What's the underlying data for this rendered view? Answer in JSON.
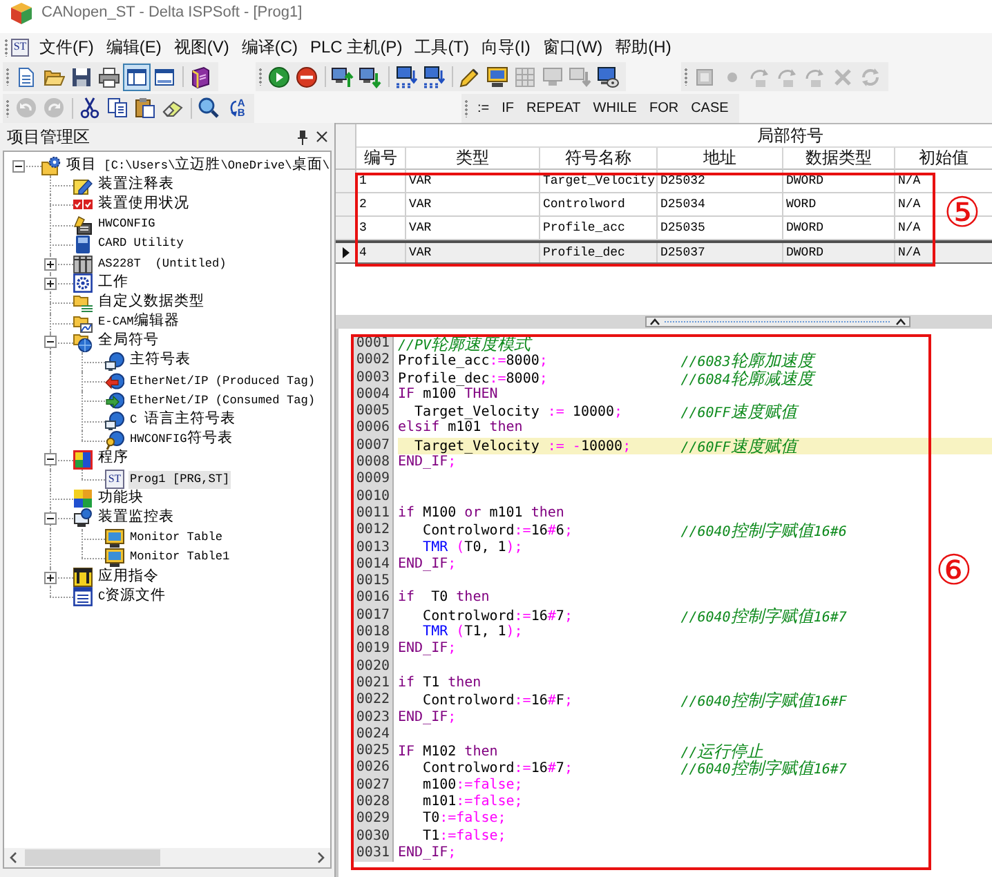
{
  "window": {
    "title": "CANopen_ST - Delta ISPSoft - [Prog1]"
  },
  "menu_bar": {
    "badge": "ST",
    "items": [
      "文件(F)",
      "编辑(E)",
      "视图(V)",
      "编译(C)",
      "PLC 主机(P)",
      "工具(T)",
      "向导(I)",
      "窗口(W)",
      "帮助(H)"
    ]
  },
  "toolbars": [
    {
      "groups": [
        {
          "sections": [
            {
              "buttons": [
                {
                  "kind": "new",
                  "disabled": false,
                  "pressed": false
                },
                {
                  "kind": "open",
                  "disabled": false,
                  "pressed": false
                },
                {
                  "kind": "save",
                  "disabled": false,
                  "pressed": false
                },
                {
                  "kind": "print",
                  "disabled": false,
                  "pressed": false
                },
                {
                  "kind": "layout",
                  "disabled": false,
                  "pressed": true
                },
                {
                  "kind": "window",
                  "disabled": false,
                  "pressed": false
                }
              ]
            },
            {
              "buttons": [
                {
                  "kind": "book",
                  "disabled": false,
                  "pressed": false
                }
              ]
            }
          ]
        },
        {
          "sections": [
            {
              "buttons": [
                {
                  "kind": "run",
                  "disabled": false
                },
                {
                  "kind": "stop",
                  "disabled": false
                }
              ]
            },
            {
              "buttons": [
                {
                  "kind": "upload",
                  "disabled": false
                },
                {
                  "kind": "download",
                  "disabled": false
                }
              ]
            },
            {
              "buttons": [
                {
                  "kind": "network",
                  "disabled": false
                },
                {
                  "kind": "network",
                  "disabled": false
                }
              ]
            },
            {
              "buttons": [
                {
                  "kind": "pencil",
                  "disabled": false
                },
                {
                  "kind": "card",
                  "disabled": false
                },
                {
                  "kind": "grid",
                  "disabled": true
                },
                {
                  "kind": "terminal",
                  "disabled": true
                },
                {
                  "kind": "transfer",
                  "disabled": true
                },
                {
                  "kind": "disc",
                  "disabled": false
                }
              ]
            }
          ]
        },
        {
          "sections": [
            {
              "buttons": [
                {
                  "kind": "module",
                  "disabled": true
                },
                {
                  "kind": "breakpoint",
                  "disabled": true
                },
                {
                  "kind": "step",
                  "disabled": true
                },
                {
                  "kind": "step",
                  "disabled": true
                },
                {
                  "kind": "step",
                  "disabled": true
                },
                {
                  "kind": "clear",
                  "disabled": true
                },
                {
                  "kind": "refresh",
                  "disabled": true
                }
              ]
            }
          ]
        }
      ]
    },
    {
      "groups": [
        {
          "sections": [
            {
              "buttons": [
                {
                  "kind": "undo",
                  "disabled": true
                },
                {
                  "kind": "redo",
                  "disabled": true
                }
              ]
            },
            {
              "buttons": [
                {
                  "kind": "cut",
                  "disabled": false
                },
                {
                  "kind": "copy",
                  "disabled": false
                },
                {
                  "kind": "paste",
                  "disabled": false
                },
                {
                  "kind": "erase",
                  "disabled": false
                }
              ]
            },
            {
              "buttons": [
                {
                  "kind": "find",
                  "disabled": false
                },
                {
                  "kind": "replace",
                  "label": "AB",
                  "disabled": false
                }
              ]
            }
          ]
        },
        {
          "sections": [
            {
              "buttons": [
                {
                  "kind": "text",
                  "label": ":=",
                  "disabled": false
                },
                {
                  "kind": "text",
                  "label": "IF",
                  "disabled": false
                },
                {
                  "kind": "text",
                  "label": "REPEAT",
                  "disabled": false
                },
                {
                  "kind": "text",
                  "label": "WHILE",
                  "disabled": false
                },
                {
                  "kind": "text",
                  "label": "FOR",
                  "disabled": false
                },
                {
                  "kind": "text",
                  "label": "CASE",
                  "disabled": false
                }
              ]
            }
          ]
        }
      ]
    }
  ],
  "project_panel": {
    "title": "项目管理区",
    "tree": [
      {
        "label": "项目 [C:\\Users\\立迈胜\\OneDrive\\桌面\\",
        "kind": "project",
        "expanded": true,
        "selected": false,
        "children": [
          {
            "label": "装置注释表",
            "kind": "note",
            "selected": false
          },
          {
            "label": "装置使用状况",
            "kind": "usage",
            "selected": false
          },
          {
            "label": "HWCONFIG",
            "kind": "hwconfig",
            "selected": false
          },
          {
            "label": "CARD Utility",
            "kind": "card",
            "selected": false
          },
          {
            "label": "AS228T  (Untitled)",
            "kind": "plc",
            "expanded": false,
            "selected": false
          },
          {
            "label": "工作",
            "kind": "task",
            "expanded": false,
            "selected": false
          },
          {
            "label": "自定义数据类型",
            "kind": "datatype",
            "selected": false
          },
          {
            "label": "E-CAM编辑器",
            "kind": "ecam",
            "selected": false
          },
          {
            "label": "全局符号",
            "kind": "globals",
            "expanded": true,
            "selected": false,
            "children": [
              {
                "label": "主符号表",
                "kind": "symbols",
                "selected": false
              },
              {
                "label": "EtherNet/IP (Produced Tag)",
                "kind": "produced",
                "selected": false
              },
              {
                "label": "EtherNet/IP (Consumed Tag)",
                "kind": "consumed",
                "selected": false
              },
              {
                "label": "C 语言主符号表",
                "kind": "symbols",
                "selected": false
              },
              {
                "label": "HWCONFIG符号表",
                "kind": "keysymbols",
                "selected": false
              }
            ]
          },
          {
            "label": "程序",
            "kind": "programs",
            "expanded": true,
            "selected": false,
            "children": [
              {
                "label": "Prog1 [PRG,ST]",
                "kind": "program",
                "badge": "ST",
                "selected": true
              }
            ]
          },
          {
            "label": "功能块",
            "kind": "blocks",
            "selected": false
          },
          {
            "label": "装置监控表",
            "kind": "monitors",
            "expanded": true,
            "selected": false,
            "children": [
              {
                "label": "Monitor Table",
                "kind": "monitor",
                "selected": false
              },
              {
                "label": "Monitor Table1",
                "kind": "monitor",
                "selected": false
              }
            ]
          },
          {
            "label": "应用指令",
            "kind": "instructions",
            "expanded": false,
            "selected": false
          },
          {
            "label": "C资源文件",
            "kind": "csource",
            "selected": false
          }
        ]
      }
    ]
  },
  "local_symbols": {
    "title": "局部符号",
    "callout": "⑤",
    "columns": [
      "编号",
      "类型",
      "符号名称",
      "地址",
      "数据类型",
      "初始值"
    ],
    "rows": [
      {
        "cells": [
          "1",
          "VAR",
          "Target_Velocity",
          "D25032",
          "DWORD",
          "N/A"
        ],
        "selected": false
      },
      {
        "cells": [
          "2",
          "VAR",
          "Controlword",
          "D25034",
          "WORD",
          "N/A"
        ],
        "selected": false
      },
      {
        "cells": [
          "3",
          "VAR",
          "Profile_acc",
          "D25035",
          "DWORD",
          "N/A"
        ],
        "selected": false
      },
      {
        "cells": [
          "4",
          "VAR",
          "Profile_dec",
          "D25037",
          "DWORD",
          "N/A"
        ],
        "selected": true
      }
    ]
  },
  "editor": {
    "callout": "⑥",
    "lines": [
      {
        "no": "0001",
        "highlighted": false,
        "code": [
          {
            "kind": "comment",
            "text": "//PV轮廓速度模式"
          }
        ]
      },
      {
        "no": "0002",
        "highlighted": false,
        "code": [
          {
            "kind": "id",
            "text": "Profile_acc"
          },
          {
            "kind": "op",
            "text": ":="
          },
          {
            "kind": "num",
            "text": "8000"
          },
          {
            "kind": "op",
            "text": ";"
          }
        ],
        "comment": "//6083轮廓加速度"
      },
      {
        "no": "0003",
        "highlighted": false,
        "code": [
          {
            "kind": "id",
            "text": "Profile_dec"
          },
          {
            "kind": "op",
            "text": ":="
          },
          {
            "kind": "num",
            "text": "8000"
          },
          {
            "kind": "op",
            "text": ";"
          }
        ],
        "comment": "//6084轮廓减速度"
      },
      {
        "no": "0004",
        "highlighted": false,
        "code": [
          {
            "kind": "kw",
            "text": "IF "
          },
          {
            "kind": "id",
            "text": "m100 "
          },
          {
            "kind": "kw",
            "text": "THEN"
          }
        ]
      },
      {
        "no": "0005",
        "highlighted": false,
        "code": [
          {
            "kind": "id",
            "text": "  Target_Velocity "
          },
          {
            "kind": "op",
            "text": ":="
          },
          {
            "kind": "num",
            "text": " 10000"
          },
          {
            "kind": "op",
            "text": ";"
          }
        ],
        "comment": "//60FF速度赋值"
      },
      {
        "no": "0006",
        "highlighted": false,
        "code": [
          {
            "kind": "kw",
            "text": "elsif "
          },
          {
            "kind": "id",
            "text": "m101 "
          },
          {
            "kind": "kw",
            "text": "then"
          }
        ]
      },
      {
        "no": "0007",
        "highlighted": true,
        "code": [
          {
            "kind": "id",
            "text": "  Target_Velocity "
          },
          {
            "kind": "op",
            "text": ":= -"
          },
          {
            "kind": "num",
            "text": "10000"
          },
          {
            "kind": "op",
            "text": ";"
          }
        ],
        "comment": "//60FF速度赋值"
      },
      {
        "no": "0008",
        "highlighted": false,
        "code": [
          {
            "kind": "kw",
            "text": "END_IF"
          },
          {
            "kind": "op",
            "text": ";"
          }
        ]
      },
      {
        "no": "0009",
        "highlighted": false
      },
      {
        "no": "0010",
        "highlighted": false
      },
      {
        "no": "0011",
        "highlighted": false,
        "code": [
          {
            "kind": "kw",
            "text": "if "
          },
          {
            "kind": "id",
            "text": "M100 "
          },
          {
            "kind": "kw",
            "text": "or "
          },
          {
            "kind": "id",
            "text": "m101 "
          },
          {
            "kind": "kw",
            "text": "then"
          }
        ]
      },
      {
        "no": "0012",
        "highlighted": false,
        "code": [
          {
            "kind": "id",
            "text": "   Controlword"
          },
          {
            "kind": "op",
            "text": ":="
          },
          {
            "kind": "num",
            "text": "16"
          },
          {
            "kind": "op",
            "text": "#"
          },
          {
            "kind": "num",
            "text": "6"
          },
          {
            "kind": "op",
            "text": ";"
          }
        ],
        "comment": "//6040控制字赋值16#6"
      },
      {
        "no": "0013",
        "highlighted": false,
        "code": [
          {
            "kind": "fn",
            "text": "   TMR "
          },
          {
            "kind": "op",
            "text": "("
          },
          {
            "kind": "id",
            "text": "T0, 1"
          },
          {
            "kind": "op",
            "text": ");"
          }
        ]
      },
      {
        "no": "0014",
        "highlighted": false,
        "code": [
          {
            "kind": "kw",
            "text": "END_IF"
          },
          {
            "kind": "op",
            "text": ";"
          }
        ]
      },
      {
        "no": "0015",
        "highlighted": false
      },
      {
        "no": "0016",
        "highlighted": false,
        "code": [
          {
            "kind": "kw",
            "text": "if  "
          },
          {
            "kind": "id",
            "text": "T0 "
          },
          {
            "kind": "kw",
            "text": "then"
          }
        ]
      },
      {
        "no": "0017",
        "highlighted": false,
        "code": [
          {
            "kind": "id",
            "text": "   Controlword"
          },
          {
            "kind": "op",
            "text": ":="
          },
          {
            "kind": "num",
            "text": "16"
          },
          {
            "kind": "op",
            "text": "#"
          },
          {
            "kind": "num",
            "text": "7"
          },
          {
            "kind": "op",
            "text": ";"
          }
        ],
        "comment": "//6040控制字赋值16#7"
      },
      {
        "no": "0018",
        "highlighted": false,
        "code": [
          {
            "kind": "fn",
            "text": "   TMR "
          },
          {
            "kind": "op",
            "text": "("
          },
          {
            "kind": "id",
            "text": "T1, 1"
          },
          {
            "kind": "op",
            "text": ");"
          }
        ]
      },
      {
        "no": "0019",
        "highlighted": false,
        "code": [
          {
            "kind": "kw",
            "text": "END_IF"
          },
          {
            "kind": "op",
            "text": ";"
          }
        ]
      },
      {
        "no": "0020",
        "highlighted": false
      },
      {
        "no": "0021",
        "highlighted": false,
        "code": [
          {
            "kind": "kw",
            "text": "if "
          },
          {
            "kind": "id",
            "text": "T1 "
          },
          {
            "kind": "kw",
            "text": "then"
          }
        ]
      },
      {
        "no": "0022",
        "highlighted": false,
        "code": [
          {
            "kind": "id",
            "text": "   Controlword"
          },
          {
            "kind": "op",
            "text": ":="
          },
          {
            "kind": "num",
            "text": "16"
          },
          {
            "kind": "op",
            "text": "#"
          },
          {
            "kind": "num",
            "text": "F"
          },
          {
            "kind": "op",
            "text": ";"
          }
        ],
        "comment": "//6040控制字赋值16#F"
      },
      {
        "no": "0023",
        "highlighted": false,
        "code": [
          {
            "kind": "kw",
            "text": "END_IF"
          },
          {
            "kind": "op",
            "text": ";"
          }
        ]
      },
      {
        "no": "0024",
        "highlighted": false
      },
      {
        "no": "0025",
        "highlighted": false,
        "code": [
          {
            "kind": "kw",
            "text": "IF "
          },
          {
            "kind": "id",
            "text": "M102 "
          },
          {
            "kind": "kw",
            "text": "then"
          }
        ],
        "comment": "//运行停止"
      },
      {
        "no": "0026",
        "highlighted": false,
        "code": [
          {
            "kind": "id",
            "text": "   Controlword"
          },
          {
            "kind": "op",
            "text": ":="
          },
          {
            "kind": "num",
            "text": "16"
          },
          {
            "kind": "op",
            "text": "#"
          },
          {
            "kind": "num",
            "text": "7"
          },
          {
            "kind": "op",
            "text": ";"
          }
        ],
        "comment": "//6040控制字赋值16#7"
      },
      {
        "no": "0027",
        "highlighted": false,
        "code": [
          {
            "kind": "id",
            "text": "   m100"
          },
          {
            "kind": "op",
            "text": ":="
          },
          {
            "kind": "lit",
            "text": "false"
          },
          {
            "kind": "op",
            "text": ";"
          }
        ]
      },
      {
        "no": "0028",
        "highlighted": false,
        "code": [
          {
            "kind": "id",
            "text": "   m101"
          },
          {
            "kind": "op",
            "text": ":="
          },
          {
            "kind": "lit",
            "text": "false"
          },
          {
            "kind": "op",
            "text": ";"
          }
        ]
      },
      {
        "no": "0029",
        "highlighted": false,
        "code": [
          {
            "kind": "id",
            "text": "   T0"
          },
          {
            "kind": "op",
            "text": ":="
          },
          {
            "kind": "lit",
            "text": "false"
          },
          {
            "kind": "op",
            "text": ";"
          }
        ]
      },
      {
        "no": "0030",
        "highlighted": false,
        "code": [
          {
            "kind": "id",
            "text": "   T1"
          },
          {
            "kind": "op",
            "text": ":="
          },
          {
            "kind": "lit",
            "text": "false"
          },
          {
            "kind": "op",
            "text": ";"
          }
        ]
      },
      {
        "no": "0031",
        "highlighted": false,
        "code": [
          {
            "kind": "kw",
            "text": "END_IF"
          },
          {
            "kind": "op",
            "text": ";"
          }
        ]
      }
    ]
  }
}
